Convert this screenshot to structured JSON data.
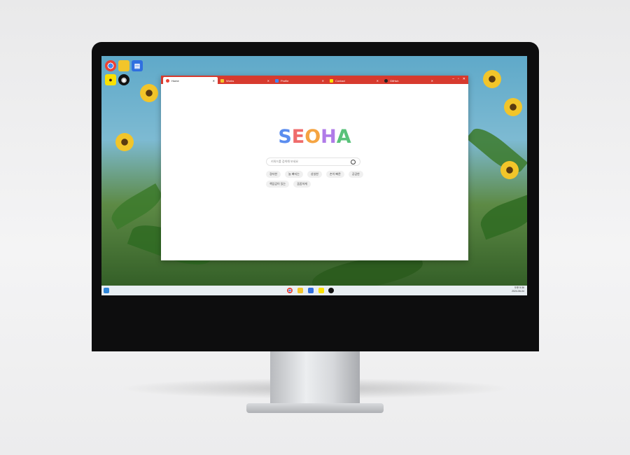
{
  "browser": {
    "tabs": [
      {
        "label": "Home",
        "color": "#ffffff",
        "active": true
      },
      {
        "label": "Works",
        "color": "#f2c52a",
        "active": false
      },
      {
        "label": "Profile",
        "color": "#4285f4",
        "active": false
      },
      {
        "label": "Contact",
        "color": "#fae100",
        "active": false
      },
      {
        "label": "GitHub",
        "color": "#222222",
        "active": false
      }
    ],
    "logo": "SEOHA",
    "logo_colors": [
      "#5b8def",
      "#ef6b6b",
      "#f5a442",
      "#b07be8",
      "#59c27a"
    ],
    "search": {
      "placeholder": "키워드를 검색해 보세요"
    },
    "chips": [
      "경자한",
      "늘 빠지는",
      "성실한",
      "손이 빠른",
      "공감한",
      "책임감이 있는",
      "꼼꼼하게"
    ]
  },
  "taskbar": {
    "time": "오후 5:36",
    "date": "2024-06-04",
    "apps": [
      "chrome-icon",
      "folder-icon",
      "docs-icon",
      "kakaotalk-icon",
      "github-icon"
    ]
  },
  "desktop": {
    "icons": [
      "chrome-icon",
      "folder-icon",
      "docs-icon",
      "kakaotalk-icon",
      "github-icon"
    ]
  }
}
